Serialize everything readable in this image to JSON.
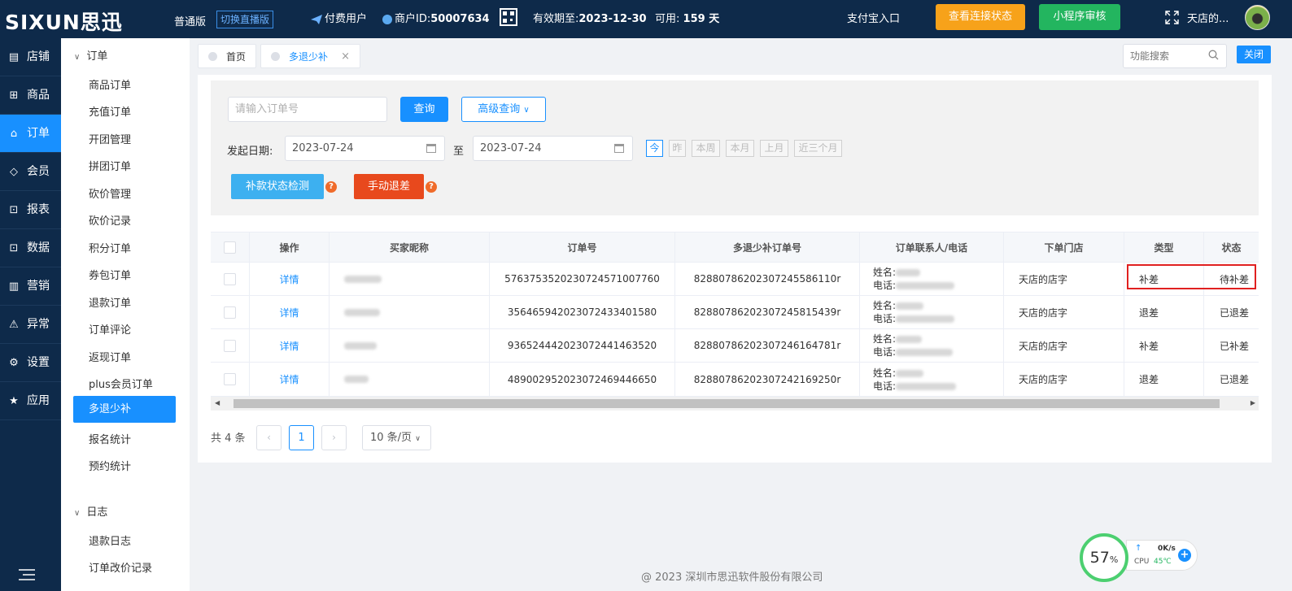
{
  "header": {
    "logo": "SIXUN思迅",
    "edition": "普通版",
    "switch_live": "切换直播版",
    "paid_user": "付费用户",
    "merchant_id_label": "商户ID:",
    "merchant_id": "50007634",
    "valid_until_label": "有效期至:",
    "valid_until": "2023-12-30",
    "available_label": "可用:",
    "available_days": "159 天",
    "alipay_entry": "支付宝入口",
    "check_connection": "查看连接状态",
    "mini_program_review": "小程序审核",
    "store_name": "天店的..."
  },
  "sidebar": {
    "items": [
      {
        "label": "店铺",
        "icon": "store-icon"
      },
      {
        "label": "商品",
        "icon": "gift-icon"
      },
      {
        "label": "订单",
        "icon": "order-icon"
      },
      {
        "label": "会员",
        "icon": "diamond-icon"
      },
      {
        "label": "报表",
        "icon": "bag-icon"
      },
      {
        "label": "数据",
        "icon": "bag-icon"
      },
      {
        "label": "营销",
        "icon": "bar-chart-icon"
      },
      {
        "label": "异常",
        "icon": "warning-icon"
      },
      {
        "label": "设置",
        "icon": "gear-icon"
      },
      {
        "label": "应用",
        "icon": "star-icon"
      }
    ],
    "active": "订单"
  },
  "submenu": {
    "order_group": "订单",
    "order_items": [
      "商品订单",
      "充值订单",
      "开团管理",
      "拼团订单",
      "砍价管理",
      "砍价记录",
      "积分订单",
      "券包订单",
      "退款订单",
      "订单评论",
      "返现订单",
      "plus会员订单",
      "多退少补",
      "报名统计",
      "预约统计"
    ],
    "active_item": "多退少补",
    "log_group": "日志",
    "log_items": [
      "退款日志",
      "订单改价记录"
    ]
  },
  "tabs": [
    {
      "label": "首页",
      "active": false
    },
    {
      "label": "多退少补",
      "active": true,
      "close": "×"
    }
  ],
  "func_search": {
    "placeholder": "功能搜索"
  },
  "close_label": "关闭",
  "filter": {
    "order_placeholder": "请输入订单号",
    "query_label": "查询",
    "advanced_label": "高级查询",
    "date_label": "发起日期:",
    "date_from": "2023-07-24",
    "date_to_sep": "至",
    "date_to": "2023-07-24",
    "quick": [
      "今",
      "昨",
      "本周",
      "本月",
      "上月",
      "近三个月"
    ],
    "quick_active": "今",
    "check_status_btn": "补款状态检测",
    "manual_refund_btn": "手动退差",
    "help": "?"
  },
  "table": {
    "columns": [
      "",
      "操作",
      "买家昵称",
      "订单号",
      "多退少补订单号",
      "订单联系人/电话",
      "下单门店",
      "类型",
      "状态"
    ],
    "rows": [
      {
        "action": "详情",
        "order_no": "5763753520230724571007760",
        "refund_no": "828807862023072455861​10r",
        "name_label": "姓名:",
        "phone_label": "电话:",
        "store": "天店的店字",
        "type": "补差",
        "status": "待补差"
      },
      {
        "action": "详情",
        "order_no": "3564659420230724334015​80",
        "refund_no": "8288078620230724581543​9r",
        "name_label": "姓名:",
        "phone_label": "电话:",
        "store": "天店的店字",
        "type": "退差",
        "status": "已退差"
      },
      {
        "action": "详情",
        "order_no": "9365244420230724414635​20",
        "refund_no": "8288078620230724616478​1r",
        "name_label": "姓名:",
        "phone_label": "电话:",
        "store": "天店的店字",
        "type": "补差",
        "status": "已补差"
      },
      {
        "action": "详情",
        "order_no": "4890029520230724694466​50",
        "refund_no": "8288078620230724216925​0r",
        "name_label": "姓名:",
        "phone_label": "电话:",
        "store": "天店的店字",
        "type": "退差",
        "status": "已退差"
      }
    ]
  },
  "pagination": {
    "total": "共 4 条",
    "prev": "‹",
    "current": "1",
    "next": "›",
    "page_size": "10 条/页"
  },
  "footer": "@ 2023 深圳市思迅软件股份有限公司",
  "monitor": {
    "percent": "57",
    "percent_unit": "%",
    "net_speed": "0K/s",
    "cpu_label": "CPU",
    "cpu_temp": "45℃",
    "plus": "+"
  },
  "colors": {
    "topbar": "#0e2a4a",
    "accent": "#1890ff",
    "orange": "#f7a21a",
    "green": "#23b55f",
    "red_button": "#e8491d",
    "highlight_box": "#e02020"
  }
}
